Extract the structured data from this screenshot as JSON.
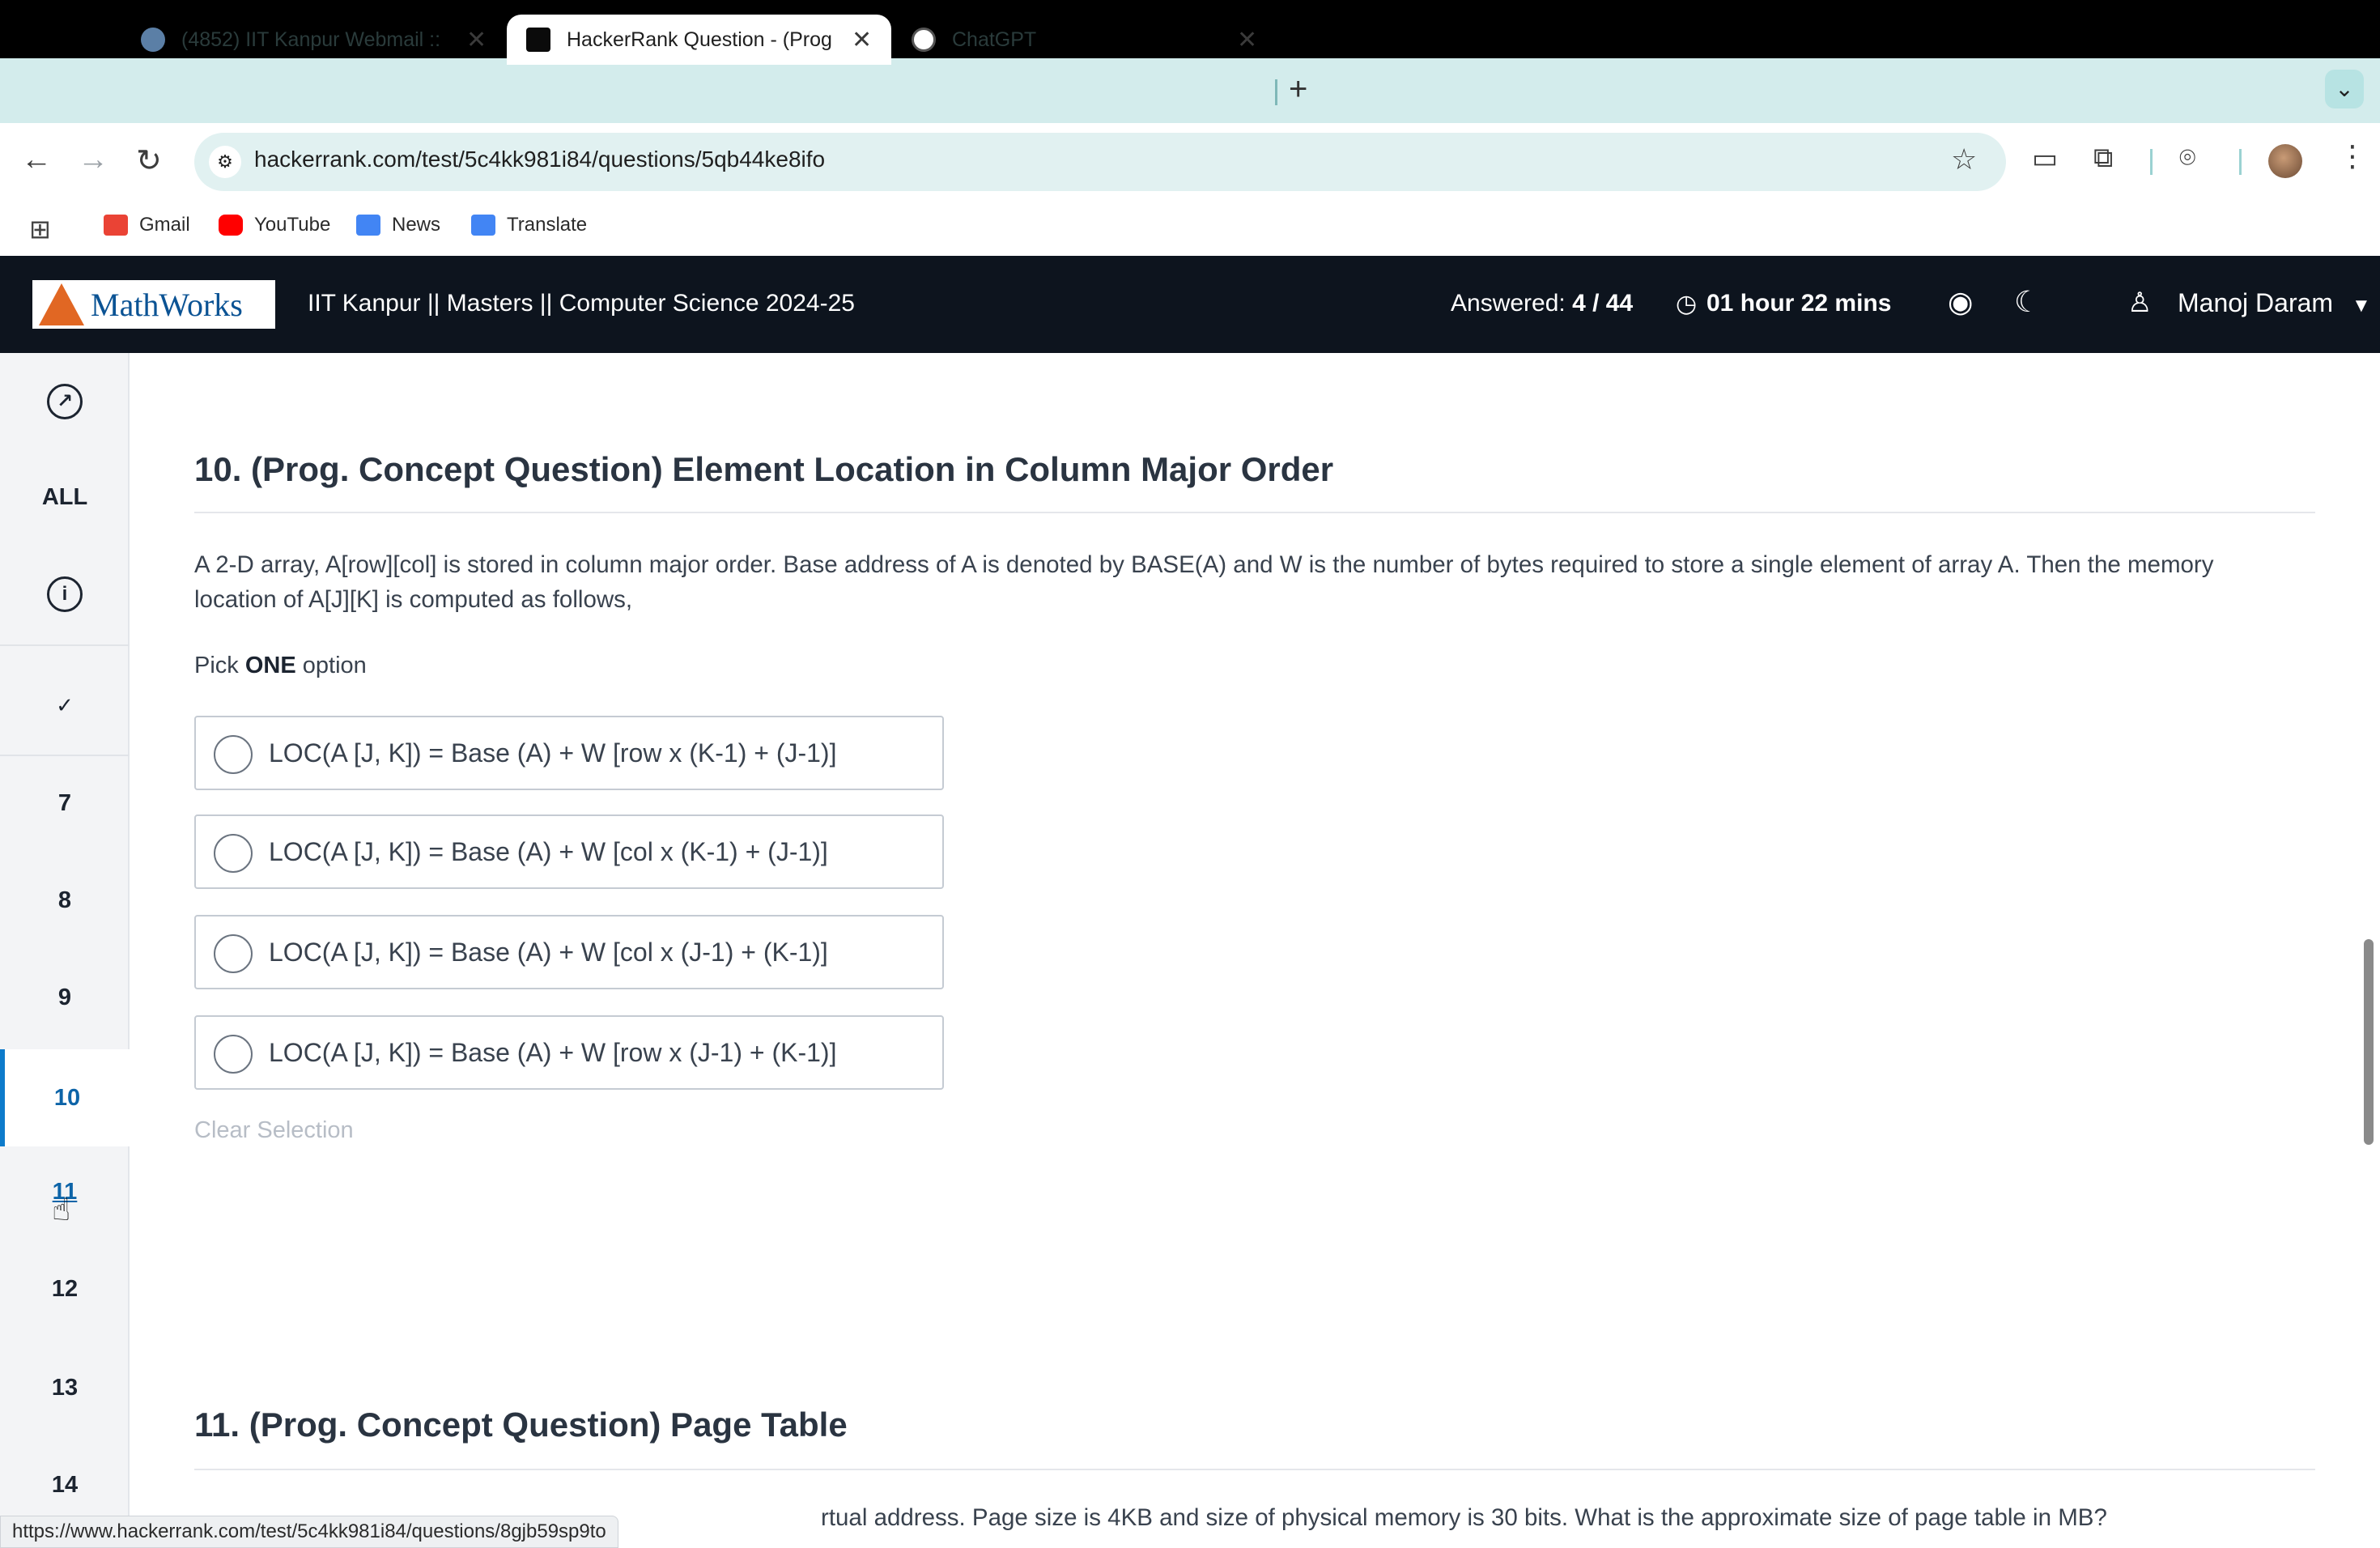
{
  "browser": {
    "tabs": [
      {
        "title": "(4852) IIT Kanpur Webmail ::",
        "close": "✕"
      },
      {
        "title": "HackerRank Question - (Prog",
        "close": "✕"
      },
      {
        "title": "ChatGPT",
        "close": "✕"
      }
    ],
    "new_tab": "+",
    "tab_menu": "⌄",
    "url": "hackerrank.com/test/5c4kk981i84/questions/5qb44ke8ifo",
    "bookmarks": [
      {
        "label": "Gmail",
        "icon": "gmail-icon",
        "color": "#ea4335"
      },
      {
        "label": "YouTube",
        "icon": "youtube-icon",
        "color": "#ff0000"
      },
      {
        "label": "News",
        "icon": "news-icon",
        "color": "#4285f4"
      },
      {
        "label": "Translate",
        "icon": "translate-icon",
        "color": "#4285f4"
      }
    ],
    "status_url": "https://www.hackerrank.com/test/5c4kk981i84/questions/8gjb59sp9to"
  },
  "header": {
    "logo_text": "MathWorks",
    "test_title": "IIT Kanpur || Masters || Computer Science 2024-25",
    "answered_label": "Answered:",
    "answered_value": "4 / 44",
    "timer": "01 hour 22 mins",
    "user_name": "Manoj Daram",
    "colors": {
      "bg": "#0d141e",
      "logo_orange": "#e16723",
      "logo_blue": "#0b5394"
    }
  },
  "sidebar": {
    "all_label": "ALL",
    "check": "✓",
    "items": [
      "7",
      "8",
      "9",
      "10",
      "11",
      "12",
      "13",
      "14"
    ],
    "current": "10",
    "accent": "#0d7bcb"
  },
  "question": {
    "title": "10. (Prog. Concept Question) Element Location in Column Major Order",
    "body": "A 2-D array, A[row][col] is stored in column major order. Base address of A is denoted by BASE(A) and W is the number of bytes required to store a single element of array A. Then the memory location of A[J][K] is computed as follows,",
    "pick_prefix": "Pick",
    "pick_bold": "ONE",
    "pick_suffix": "option",
    "options": [
      "LOC(A [J, K]) = Base (A) + W [row x (K-1) + (J-1)]",
      "LOC(A [J, K]) = Base (A) + W [col x (K-1) + (J-1)]",
      "LOC(A [J, K]) = Base (A) + W [col x (J-1) + (K-1)]",
      "LOC(A [J, K]) = Base (A) + W [row x (J-1) + (K-1)]"
    ],
    "clear_label": "Clear Selection"
  },
  "next_question": {
    "title": "11. (Prog. Concept Question) Page Table",
    "body_visible": "rtual address. Page size is 4KB and size of physical memory is 30 bits. What is the approximate size of page table in MB?"
  }
}
